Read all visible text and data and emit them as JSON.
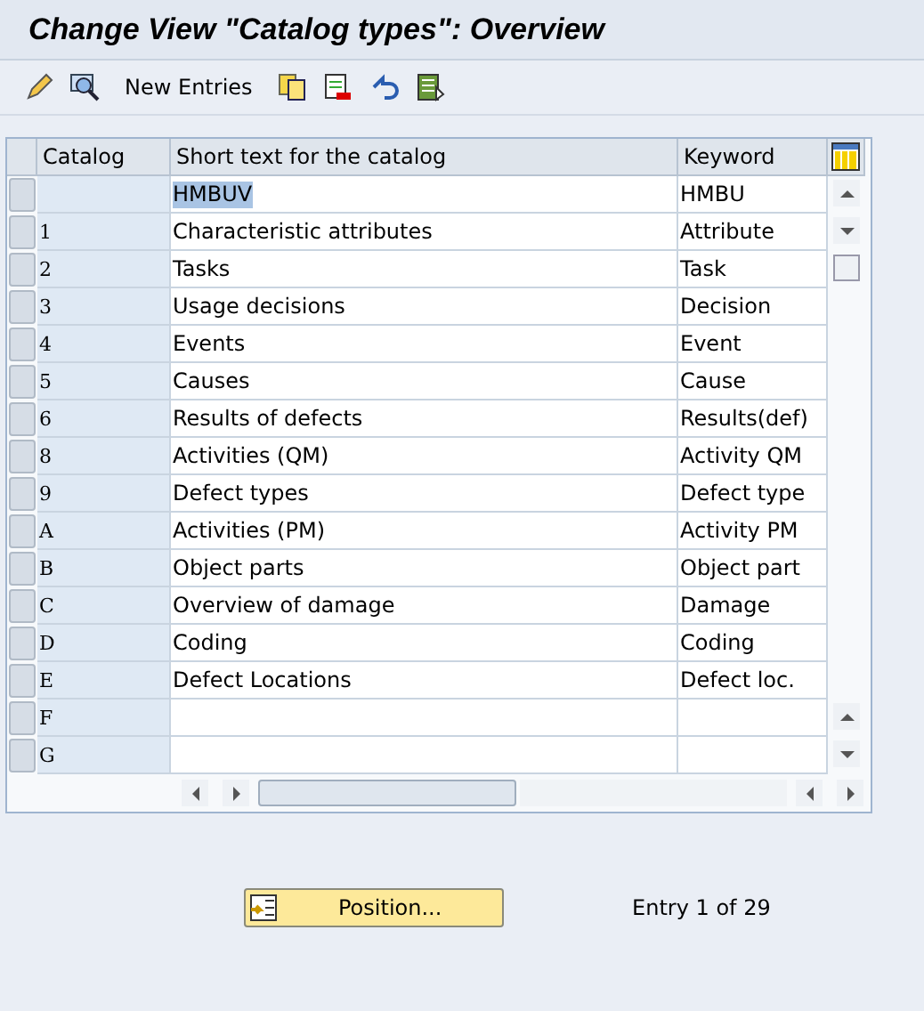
{
  "window": {
    "title": "Change View \"Catalog types\": Overview"
  },
  "toolbar": {
    "new_entries": "New Entries"
  },
  "table": {
    "columns": [
      "Catalog",
      "Short text for the catalog",
      "Keyword"
    ],
    "rows": [
      {
        "catalog": "",
        "text": "HMBUV",
        "keyword": "HMBU",
        "highlighted": true
      },
      {
        "catalog": "1",
        "text": "Characteristic attributes",
        "keyword": "Attribute",
        "highlighted": false
      },
      {
        "catalog": "2",
        "text": "Tasks",
        "keyword": "Task",
        "highlighted": false
      },
      {
        "catalog": "3",
        "text": "Usage decisions",
        "keyword": "Decision",
        "highlighted": false
      },
      {
        "catalog": "4",
        "text": "Events",
        "keyword": "Event",
        "highlighted": false
      },
      {
        "catalog": "5",
        "text": "Causes",
        "keyword": "Cause",
        "highlighted": false
      },
      {
        "catalog": "6",
        "text": "Results of defects",
        "keyword": "Results(def)",
        "highlighted": false
      },
      {
        "catalog": "8",
        "text": "Activities (QM)",
        "keyword": "Activity QM",
        "highlighted": false
      },
      {
        "catalog": "9",
        "text": "Defect types",
        "keyword": "Defect type",
        "highlighted": false
      },
      {
        "catalog": "A",
        "text": "Activities (PM)",
        "keyword": "Activity PM",
        "highlighted": false
      },
      {
        "catalog": "B",
        "text": "Object parts",
        "keyword": "Object part",
        "highlighted": false
      },
      {
        "catalog": "C",
        "text": "Overview of damage",
        "keyword": "Damage",
        "highlighted": false
      },
      {
        "catalog": "D",
        "text": "Coding",
        "keyword": "Coding",
        "highlighted": false
      },
      {
        "catalog": "E",
        "text": "Defect Locations",
        "keyword": "Defect loc.",
        "highlighted": false
      },
      {
        "catalog": "F",
        "text": "",
        "keyword": "",
        "highlighted": false
      },
      {
        "catalog": "G",
        "text": "",
        "keyword": "",
        "highlighted": false
      }
    ]
  },
  "footer": {
    "position_button": "Position...",
    "entry_info": "Entry 1 of 29"
  }
}
